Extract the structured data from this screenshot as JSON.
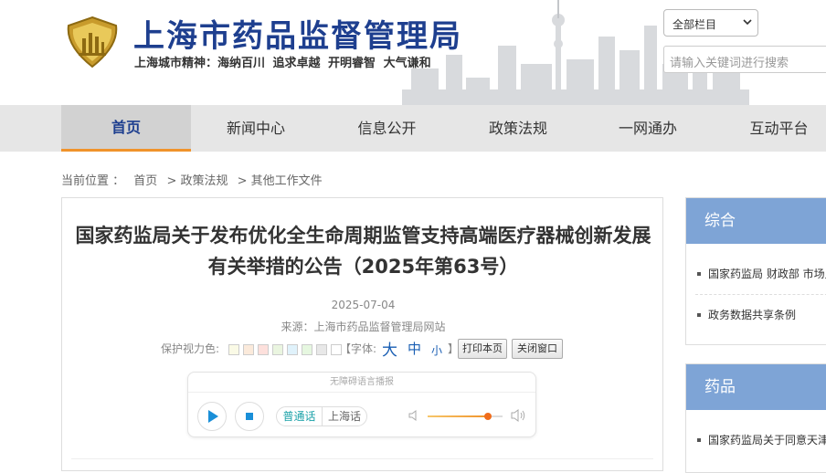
{
  "header": {
    "site_title": "上海市药品监督管理局",
    "slogan": "上海城市精神：海纳百川  追求卓越  开明睿智  大气谦和",
    "logo_icon": "emblem-icon",
    "scope_select_value": "全部栏目",
    "search_placeholder": "请输入关键词进行搜索"
  },
  "nav": {
    "items": [
      {
        "label": "首页",
        "active": true
      },
      {
        "label": "新闻中心",
        "active": false
      },
      {
        "label": "信息公开",
        "active": false
      },
      {
        "label": "政策法规",
        "active": false
      },
      {
        "label": "一网通办",
        "active": false
      },
      {
        "label": "互动平台",
        "active": false
      }
    ]
  },
  "breadcrumb": {
    "prefix": "当前位置 ：",
    "items": [
      "首页",
      "> 政策法规",
      "> 其他工作文件"
    ]
  },
  "article": {
    "title": "国家药监局关于发布优化全生命周期监管支持高端医疗器械创新发展有关举措的公告（2025年第63号）",
    "date": "2025-07-04",
    "source": "来源：上海市药品监督管理局网站",
    "eye_care_label": "保护视力色:",
    "eye_care_colors": [
      "#fafae6",
      "#fbeadb",
      "#fde0dc",
      "#eaf5e0",
      "#e0f2fb",
      "#e6f7e0",
      "#e8e8e8",
      "#ffffff"
    ],
    "font_label": "【字体:",
    "font_big": "大",
    "font_mid": "中",
    "font_small": "小",
    "font_close": "】",
    "print_label": "打印本页",
    "close_label": "关闭窗口"
  },
  "player": {
    "title": "无障碍语言播报",
    "lang_options": [
      "普通话",
      "上海话"
    ],
    "selected_lang": "普通话",
    "volume_percent": 80
  },
  "sidebar": {
    "boxes": [
      {
        "title": "综合",
        "items": [
          "国家药监局 财政部 市场监管总局",
          "政务数据共享条例"
        ]
      },
      {
        "title": "药品",
        "items": [
          "国家药监局关于同意天津药品"
        ]
      }
    ]
  },
  "colors": {
    "brand_blue": "#1e3f8f",
    "nav_accent": "#f0932b",
    "sidebar_head": "#7ea4d6"
  }
}
